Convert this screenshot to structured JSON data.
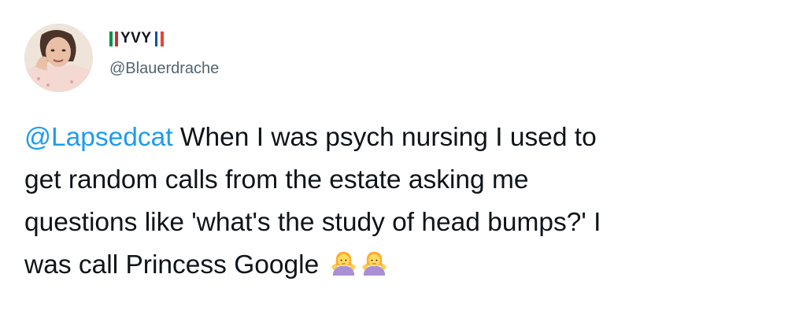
{
  "user": {
    "display_name": "YVY",
    "handle": "@Blauerdrache",
    "flag_before": "italy-flag-icon",
    "flag_after": "france-flag-icon"
  },
  "tweet": {
    "mention": "@Lapsedcat",
    "line1_rest": " When I was psych nursing I used to",
    "line2": "get random calls from the estate asking me",
    "line3": "questions like 'what's the study of head bumps?' I",
    "line4": "was call Princess Google",
    "emoji": [
      "person-shrugging-icon",
      "person-shrugging-icon"
    ]
  },
  "colors": {
    "text": "#0f1419",
    "secondary": "#536471",
    "accent": "#1d9bf0",
    "italy": [
      "#009246",
      "#ffffff",
      "#ce2b37"
    ],
    "france": [
      "#0055a4",
      "#ffffff",
      "#ef4135"
    ]
  }
}
